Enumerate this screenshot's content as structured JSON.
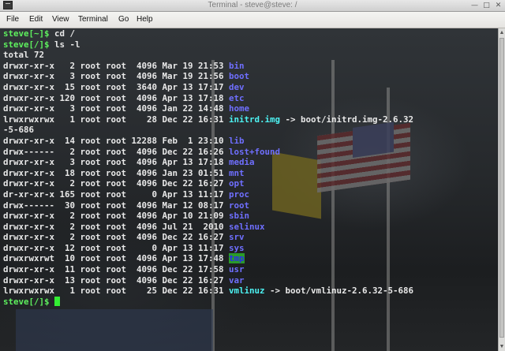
{
  "window": {
    "title": "Terminal - steve@steve: /",
    "icons": {
      "app": "terminal-icon",
      "minimize": "minimize-icon",
      "maximize": "maximize-icon",
      "close": "close-icon"
    }
  },
  "menubar": {
    "items": [
      "File",
      "Edit",
      "View",
      "Terminal",
      "Go",
      "Help"
    ]
  },
  "terminal": {
    "lines": [
      [
        [
          "ps",
          "steve[~]$"
        ],
        [
          "",
          "cd /"
        ]
      ],
      [
        [
          "ps",
          "steve[/]$"
        ],
        [
          "",
          "ls -l"
        ]
      ],
      [
        [
          "",
          "total 72"
        ]
      ],
      [
        [
          "",
          "drwxr-xr-x   2 root root  4096 Mar 19 21:53 "
        ],
        [
          "dir",
          "bin"
        ]
      ],
      [
        [
          "",
          "drwxr-xr-x   3 root root  4096 Mar 19 21:56 "
        ],
        [
          "dir",
          "boot"
        ]
      ],
      [
        [
          "",
          "drwxr-xr-x  15 root root  3640 Apr 13 17:17 "
        ],
        [
          "dir",
          "dev"
        ]
      ],
      [
        [
          "",
          "drwxr-xr-x 120 root root  4096 Apr 13 17:18 "
        ],
        [
          "dir",
          "etc"
        ]
      ],
      [
        [
          "",
          "drwxr-xr-x   3 root root  4096 Jan 22 14:48 "
        ],
        [
          "dir",
          "home"
        ]
      ],
      [
        [
          "",
          "lrwxrwxrwx   1 root root    28 Dec 22 16:31 "
        ],
        [
          "link",
          "initrd.img"
        ],
        [
          "",
          " -> boot/initrd.img-2.6.32"
        ]
      ],
      [
        [
          "",
          "-5-686"
        ]
      ],
      [
        [
          "",
          "drwxr-xr-x  14 root root 12288 Feb  1 23:10 "
        ],
        [
          "dir",
          "lib"
        ]
      ],
      [
        [
          "",
          "drwx------   2 root root  4096 Dec 22 16:26 "
        ],
        [
          "dir",
          "lost+found"
        ]
      ],
      [
        [
          "",
          "drwxr-xr-x   3 root root  4096 Apr 13 17:18 "
        ],
        [
          "dir",
          "media"
        ]
      ],
      [
        [
          "",
          "drwxr-xr-x  18 root root  4096 Jan 23 01:51 "
        ],
        [
          "dir",
          "mnt"
        ]
      ],
      [
        [
          "",
          "drwxr-xr-x   2 root root  4096 Dec 22 16:27 "
        ],
        [
          "dir",
          "opt"
        ]
      ],
      [
        [
          "",
          "dr-xr-xr-x 165 root root     0 Apr 13 11:17 "
        ],
        [
          "dir",
          "proc"
        ]
      ],
      [
        [
          "",
          "drwx------  30 root root  4096 Mar 12 08:17 "
        ],
        [
          "dir",
          "root"
        ]
      ],
      [
        [
          "",
          "drwxr-xr-x   2 root root  4096 Apr 10 21:09 "
        ],
        [
          "dir",
          "sbin"
        ]
      ],
      [
        [
          "",
          "drwxr-xr-x   2 root root  4096 Jul 21  2010 "
        ],
        [
          "dir",
          "selinux"
        ]
      ],
      [
        [
          "",
          "drwxr-xr-x   2 root root  4096 Dec 22 16:27 "
        ],
        [
          "dir",
          "srv"
        ]
      ],
      [
        [
          "",
          "drwxr-xr-x  12 root root     0 Apr 13 11:17 "
        ],
        [
          "dir",
          "sys"
        ]
      ],
      [
        [
          "",
          "drwxrwxrwt  10 root root  4096 Apr 13 17:48 "
        ],
        [
          "hl",
          "tmp"
        ]
      ],
      [
        [
          "",
          "drwxr-xr-x  11 root root  4096 Dec 22 17:58 "
        ],
        [
          "dir",
          "usr"
        ]
      ],
      [
        [
          "",
          "drwxr-xr-x  13 root root  4096 Dec 22 16:27 "
        ],
        [
          "dir",
          "var"
        ]
      ],
      [
        [
          "",
          "lrwxrwxrwx   1 root root    25 Dec 22 16:31 "
        ],
        [
          "link",
          "vmlinuz"
        ],
        [
          "",
          " -> boot/vmlinuz-2.6.32-5-686"
        ]
      ],
      [
        [
          "ps",
          "steve[/]$"
        ],
        [
          "",
          ""
        ]
      ]
    ]
  }
}
